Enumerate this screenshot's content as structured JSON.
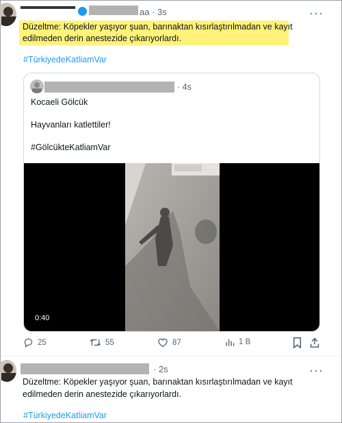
{
  "tweet1": {
    "time": "3s",
    "name_suffix": "aa",
    "text_line1": "Düzeltme: Köpekler yaşıyor şuan, barınaktan kısırlaştırılmadan ve kayıt",
    "text_line2": "edilmeden derin anestezide çıkarıyorlardı.",
    "hashtag": "#TürkiyedeKatliamVar",
    "menu_icon": "more-dots-icon"
  },
  "quoted": {
    "time": "4s",
    "line1": "Kocaeli Gölcük",
    "line2": "Hayvanları katlettiler!",
    "hashtag": "#GölcükteKatliamVar",
    "video_duration": "0:40"
  },
  "actions": {
    "replies": "25",
    "retweets": "55",
    "likes": "87",
    "views": "1 B",
    "icons": [
      "reply-icon",
      "retweet-icon",
      "like-icon",
      "views-icon",
      "bookmark-icon",
      "share-icon"
    ]
  },
  "tweet2": {
    "time": "2s",
    "text_line1": "Düzeltme: Köpekler yaşıyor şuan, barınaktan kısırlaştırılmadan ve kayıt",
    "text_line2": "edilmeden derin anestezide çıkarıyorlardı.",
    "hashtag": "#TürkiyedeKatliamVar",
    "menu_icon": "more-dots-icon"
  },
  "colors": {
    "highlight": "#fff27a",
    "link": "#1d9bf0",
    "muted": "#536471",
    "border": "#cfd9de"
  }
}
